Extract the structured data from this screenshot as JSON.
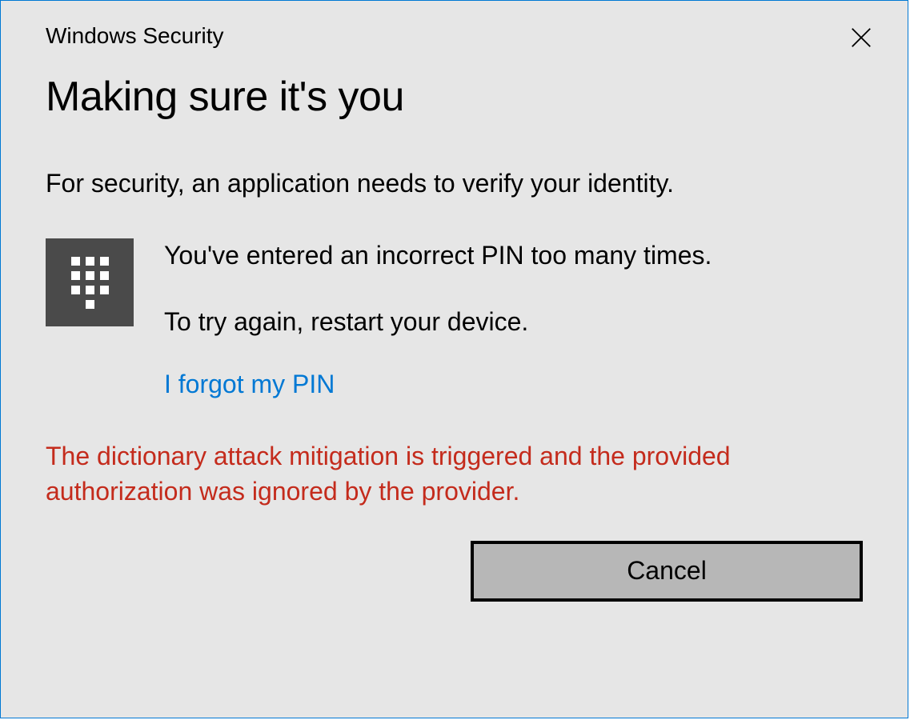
{
  "dialog": {
    "app_title": "Windows Security",
    "heading": "Making sure it's you",
    "description": "For security, an application needs to verify your identity.",
    "message_line1": "You've entered an incorrect PIN too many times.",
    "message_line2": "To try again, restart your device.",
    "forgot_link": "I forgot my PIN",
    "error_text": "The dictionary attack mitigation is triggered and the provided authorization was ignored by the provider.",
    "cancel_button": "Cancel"
  }
}
